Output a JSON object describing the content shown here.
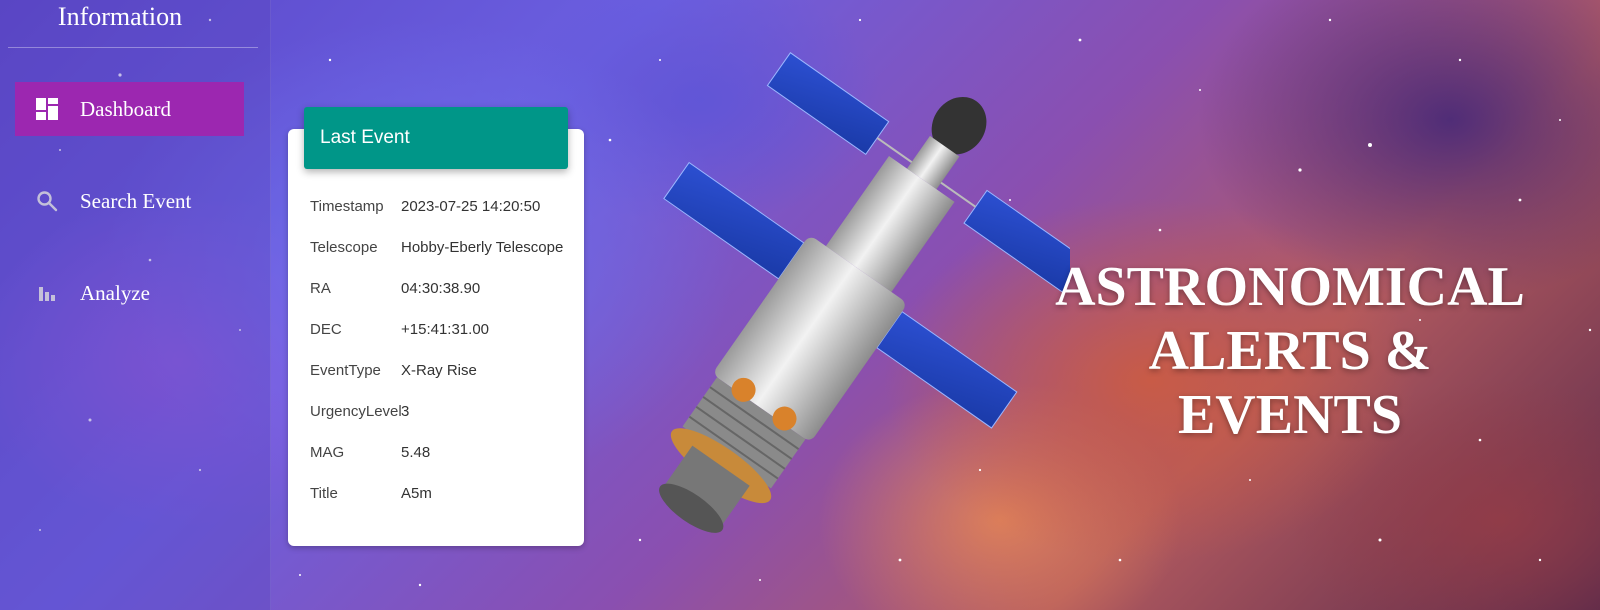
{
  "sidebar": {
    "title": "Information",
    "items": [
      {
        "label": "Dashboard",
        "icon": "dashboard-icon",
        "active": true
      },
      {
        "label": "Search Event",
        "icon": "search-icon",
        "active": false
      },
      {
        "label": "Analyze",
        "icon": "bar-chart-icon",
        "active": false
      }
    ]
  },
  "card": {
    "header": "Last Event",
    "rows": [
      {
        "label": "Timestamp",
        "value": "2023-07-25 14:20:50"
      },
      {
        "label": "Telescope",
        "value": "Hobby-Eberly Telescope"
      },
      {
        "label": "RA",
        "value": "04:30:38.90"
      },
      {
        "label": "DEC",
        "value": "+15:41:31.00"
      },
      {
        "label": "EventType",
        "value": "X-Ray Rise"
      },
      {
        "label": "UrgencyLevel",
        "value": "3"
      },
      {
        "label": "MAG",
        "value": "5.48"
      },
      {
        "label": "Title",
        "value": "A5m"
      }
    ]
  },
  "hero": {
    "line1": "ASTRONOMICAL",
    "line2": "ALERTS & EVENTS"
  },
  "colors": {
    "active_nav": "#9c27b0",
    "card_header": "#009688"
  }
}
